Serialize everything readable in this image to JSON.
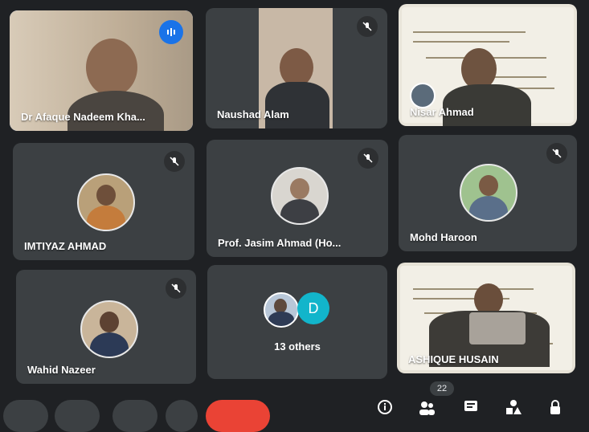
{
  "participants": [
    {
      "name": "Dr Afaque Nadeem Kha..."
    },
    {
      "name": "Naushad Alam"
    },
    {
      "name": "Nisar Ahmad"
    },
    {
      "name": "IMTIYAZ AHMAD"
    },
    {
      "name": "Prof. Jasim Ahmad (Ho..."
    },
    {
      "name": "Mohd Haroon"
    },
    {
      "name": "Wahid Nazeer"
    },
    {
      "name": "13 others",
      "avatar_letter": "D"
    },
    {
      "name": "ASHIQUE HUSAIN"
    }
  ],
  "participant_count": "22",
  "colors": {
    "tile_bg": "#3c4043",
    "active_border": "#8ab4f8",
    "end_call": "#ea4335",
    "avatar_d": "#12b5cb"
  },
  "icons": [
    "speaking-icon",
    "mic-off-icon",
    "info-icon",
    "people-icon",
    "chat-icon",
    "activities-icon",
    "lock-icon"
  ]
}
